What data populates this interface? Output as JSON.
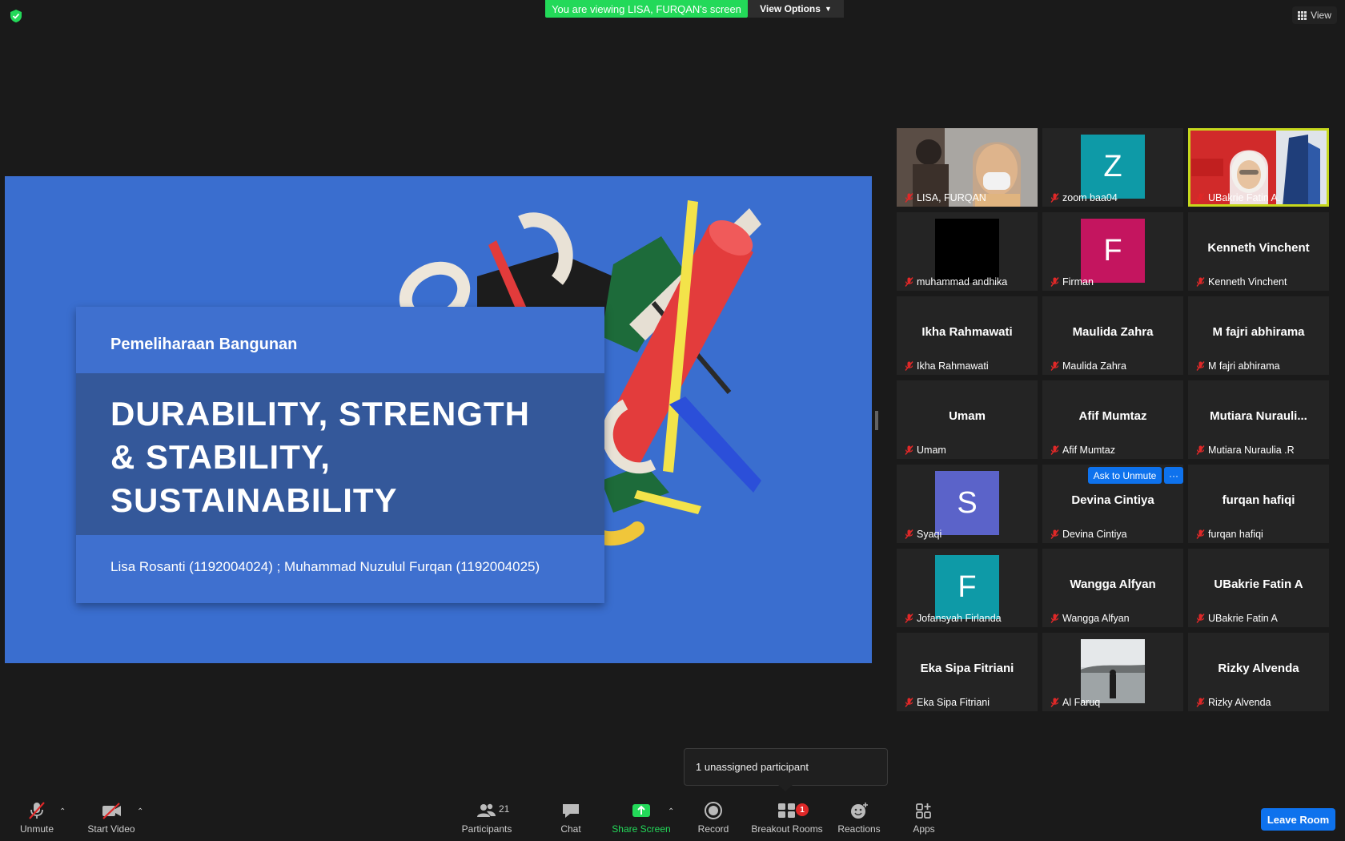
{
  "top_bar": {
    "viewing_banner": "You are viewing LISA, FURQAN's screen",
    "view_options_label": "View Options",
    "view_label": "View"
  },
  "slide": {
    "course": "Pemeliharaan Bangunan",
    "title_lines": [
      "DURABILITY, STRENGTH",
      "& STABILITY,",
      "SUSTAINABILITY"
    ],
    "authors": "Lisa Rosanti (1192004024) ; Muhammad Nuzulul Furqan (1192004025)"
  },
  "gallery": {
    "participants": [
      {
        "name": "LISA, FURQAN",
        "display": "",
        "type": "video"
      },
      {
        "name": "zoom baa04",
        "display": "Z",
        "type": "avatar",
        "color": "#0e9aa7"
      },
      {
        "name": "UBakrie Fatin A.",
        "display": "",
        "type": "video-active"
      },
      {
        "name": "muhammad andhika",
        "display": "",
        "type": "black"
      },
      {
        "name": "Firman",
        "display": "F",
        "type": "avatar",
        "color": "#c4155f"
      },
      {
        "name": "Kenneth Vinchent",
        "display": "Kenneth Vinchent",
        "type": "text"
      },
      {
        "name": "Ikha Rahmawati",
        "display": "Ikha Rahmawati",
        "type": "text"
      },
      {
        "name": "Maulida Zahra",
        "display": "Maulida Zahra",
        "type": "text"
      },
      {
        "name": "M fajri abhirama",
        "display": "M fajri abhirama",
        "type": "text"
      },
      {
        "name": "Umam",
        "display": "Umam",
        "type": "text"
      },
      {
        "name": "Afif Mumtaz",
        "display": "Afif Mumtaz",
        "type": "text"
      },
      {
        "name": "Mutiara Nuraulia .R",
        "display": "Mutiara  Nurauli...",
        "type": "text"
      },
      {
        "name": "Syaqi",
        "display": "S",
        "type": "avatar",
        "color": "#5b63c9"
      },
      {
        "name": "Devina Cintiya",
        "display": "Devina Cintiya",
        "type": "text"
      },
      {
        "name": "furqan hafiqi",
        "display": "furqan hafiqi",
        "type": "text"
      },
      {
        "name": "Jofansyah Firlanda",
        "display": "F",
        "type": "avatar",
        "color": "#0e9aa7"
      },
      {
        "name": "Wangga Alfyan",
        "display": "Wangga Alfyan",
        "type": "text"
      },
      {
        "name": "UBakrie Fatin A",
        "display": "UBakrie Fatin A",
        "type": "text"
      },
      {
        "name": "Eka Sipa Fitriani",
        "display": "Eka Sipa Fitriani",
        "type": "text"
      },
      {
        "name": "Al Faruq",
        "display": "",
        "type": "photo"
      },
      {
        "name": "Rizky Alvenda",
        "display": "Rizky Alvenda",
        "type": "text"
      }
    ],
    "ask_to_unmute_label": "Ask to Unmute",
    "more_label": "···"
  },
  "tooltip": {
    "text": "1 unassigned participant"
  },
  "toolbar": {
    "unmute": "Unmute",
    "start_video": "Start Video",
    "participants": "Participants",
    "participants_count": "21",
    "chat": "Chat",
    "share_screen": "Share Screen",
    "record": "Record",
    "breakout_rooms": "Breakout Rooms",
    "breakout_badge": "1",
    "reactions": "Reactions",
    "apps": "Apps",
    "leave_room": "Leave Room"
  },
  "colors": {
    "share_green": "#23d959",
    "accent_blue": "#0e72ed",
    "active_speaker": "#c6d81d",
    "muted_red": "#e02828"
  }
}
